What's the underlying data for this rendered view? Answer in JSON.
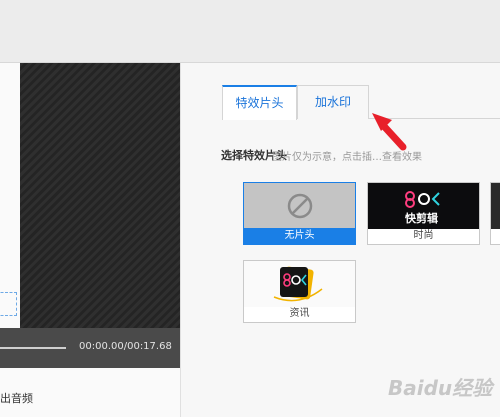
{
  "player": {
    "time": "00:00.00/00:17.68",
    "progress": 0.0
  },
  "audio": {
    "label": "出音频"
  },
  "tabs": [
    {
      "label": "特效片头",
      "active": true
    },
    {
      "label": "加水印",
      "active": false
    }
  ],
  "intro_section": {
    "title": "选择特效片头",
    "hint": "图片仅为示意，点击插…查看效果"
  },
  "thumbnails": [
    {
      "label": "无片头",
      "selected": true,
      "icon": "no-entry-icon"
    },
    {
      "label": "时尚",
      "selected": false,
      "logo_text": "快剪辑"
    },
    {
      "label": "资讯",
      "selected": false
    }
  ],
  "watermark": {
    "text": "Baidu经验"
  },
  "colors": {
    "accent": "#1a7fe6",
    "arrow": "#e8202a",
    "player_bar": "#4a4a4a"
  }
}
